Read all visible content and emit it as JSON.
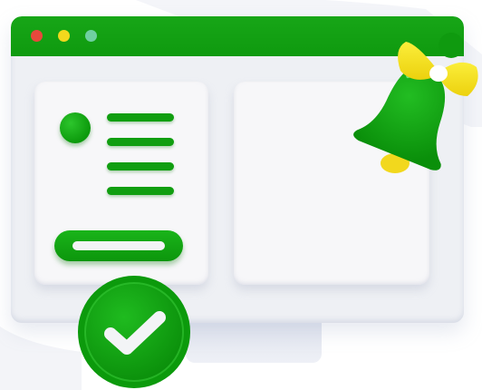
{
  "window": {
    "controls": [
      "close-dot",
      "minimize-dot",
      "maximize-dot"
    ]
  },
  "colors": {
    "brand_green": "#109e10",
    "titlebar_green": "#17a617",
    "dot_red": "#e8483c",
    "dot_yellow": "#f2d81d",
    "dot_teal": "#6fd0a2",
    "bow_yellow": "#f7e21a",
    "window_bg": "#eef0f4",
    "panel_bg": "#f7f7f9"
  },
  "icons": {
    "notification": "bell-icon",
    "success": "checkmark-icon",
    "profile": "avatar"
  }
}
